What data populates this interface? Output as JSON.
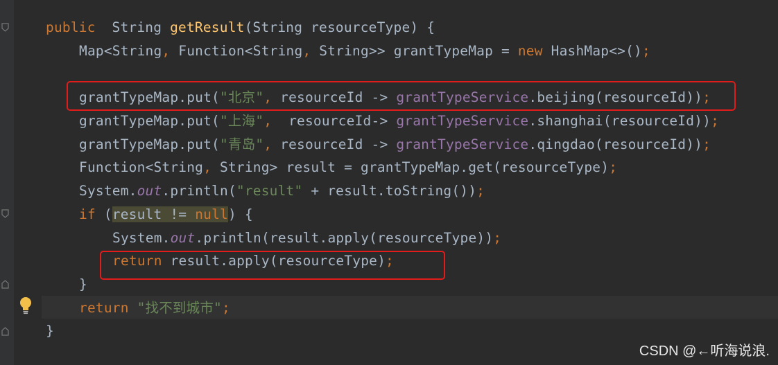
{
  "editor": {
    "lines": [
      {
        "parts": [
          [
            "kw",
            "public"
          ],
          [
            "",
            "  "
          ],
          [
            "",
            "String"
          ],
          [
            "",
            ""
          ],
          [
            "fn-decl",
            " getResult"
          ],
          [
            "",
            "(String resourceType) {"
          ]
        ]
      },
      {
        "parts": [
          [
            "",
            "Map<String"
          ],
          [
            "kw",
            ","
          ],
          [
            "",
            " Function<String"
          ],
          [
            "kw",
            ","
          ],
          [
            "",
            " String>> grantTypeMap = "
          ],
          [
            "kw",
            "new"
          ],
          [
            "",
            " HashMap<>()"
          ],
          [
            "kw",
            ";"
          ]
        ]
      },
      {
        "parts": [
          [
            "",
            ""
          ]
        ]
      },
      {
        "parts": [
          [
            "",
            "grantTypeMap.put("
          ],
          [
            "str",
            "\"北京\""
          ],
          [
            "kw",
            ","
          ],
          [
            "",
            " resourceId -> "
          ],
          [
            "field",
            "grantTypeService"
          ],
          [
            "",
            ".beijing(resourceId))"
          ],
          [
            "kw",
            ";"
          ]
        ]
      },
      {
        "parts": [
          [
            "",
            "grantTypeMap.put("
          ],
          [
            "str",
            "\"上海\""
          ],
          [
            "kw",
            ","
          ],
          [
            "",
            "  resourceId-> "
          ],
          [
            "field",
            "grantTypeService"
          ],
          [
            "",
            ".shanghai(resourceId))"
          ],
          [
            "kw",
            ";"
          ]
        ]
      },
      {
        "parts": [
          [
            "",
            "grantTypeMap.put("
          ],
          [
            "str",
            "\"青岛\""
          ],
          [
            "kw",
            ","
          ],
          [
            "",
            " resourceId -> "
          ],
          [
            "field",
            "grantTypeService"
          ],
          [
            "",
            ".qingdao(resourceId))"
          ],
          [
            "kw",
            ";"
          ]
        ]
      },
      {
        "parts": [
          [
            "",
            "Function<String"
          ],
          [
            "kw",
            ","
          ],
          [
            "",
            " String> result = grantTypeMap.get(resourceType)"
          ],
          [
            "kw",
            ";"
          ]
        ]
      },
      {
        "parts": [
          [
            "",
            "System."
          ],
          [
            "italic",
            "out"
          ],
          [
            "",
            ".println("
          ],
          [
            "str",
            "\"result\""
          ],
          [
            "",
            " + result.toString())"
          ],
          [
            "kw",
            ";"
          ]
        ]
      },
      {
        "parts": [
          [
            "kw",
            "if"
          ],
          [
            "",
            " ("
          ],
          [
            "hl2",
            "result != "
          ],
          [
            "kw hl2",
            "null"
          ],
          [
            "",
            ") {"
          ]
        ]
      },
      {
        "parts": [
          [
            "",
            "System."
          ],
          [
            "italic",
            "out"
          ],
          [
            "",
            ".println(result.apply(resourceType))"
          ],
          [
            "kw",
            ";"
          ]
        ]
      },
      {
        "parts": [
          [
            "kw",
            "return"
          ],
          [
            "",
            " result.apply(resourceType)"
          ],
          [
            "kw",
            ";"
          ]
        ]
      },
      {
        "parts": [
          [
            "",
            "}"
          ]
        ]
      },
      {
        "parts": [
          [
            "kw",
            "return"
          ],
          [
            "",
            " "
          ],
          [
            "str",
            "\"找不到城市\""
          ],
          [
            "kw",
            ";"
          ]
        ]
      },
      {
        "parts": [
          [
            "",
            "}"
          ]
        ]
      }
    ]
  },
  "watermark": "CSDN @←听海说浪."
}
